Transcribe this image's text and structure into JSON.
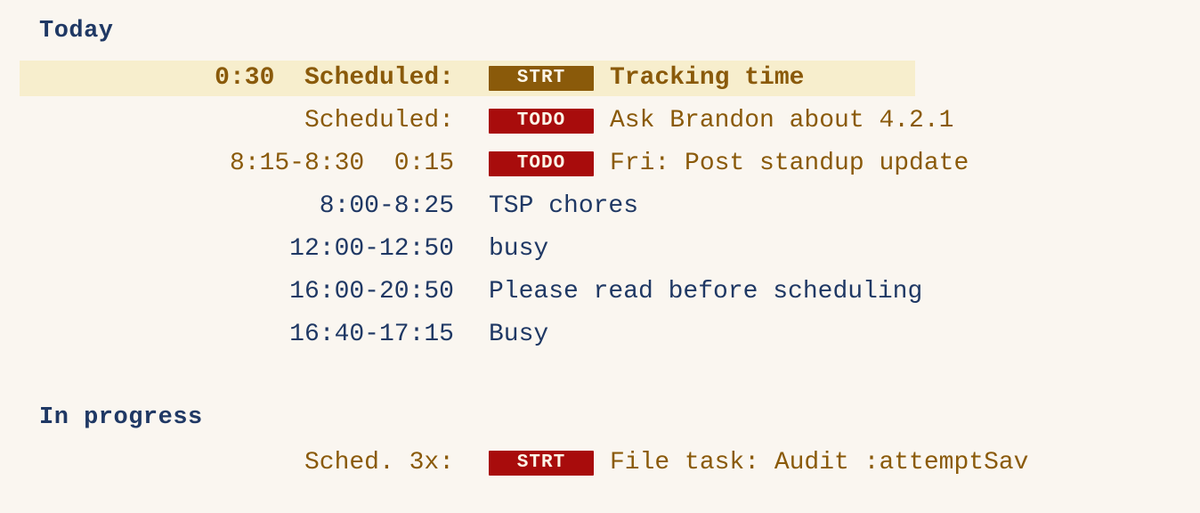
{
  "background_color": "#faf6f0",
  "colors": {
    "header": "#1f3864",
    "brown": "#8a5a0a",
    "navy": "#1f3864",
    "badge_todo": "#a80c0c",
    "badge_strt_brown": "#8a5a0a",
    "badge_strt_red": "#a80c0c",
    "row_highlight": "#f7eecd"
  },
  "sections": {
    "today": {
      "header": "Today",
      "rows": [
        {
          "time": "0:30  Scheduled:",
          "time_color": "brown",
          "bold": true,
          "badge": "STRT",
          "badge_color": "brown",
          "title": "Tracking time",
          "title_color": "brown",
          "highlighted": true
        },
        {
          "time": "Scheduled:",
          "time_color": "brown",
          "bold": false,
          "badge": "TODO",
          "badge_color": "red",
          "title": "Ask Brandon about 4.2.1",
          "title_color": "brown",
          "highlighted": false
        },
        {
          "time": "8:15-8:30  0:15",
          "time_color": "brown",
          "bold": false,
          "badge": "TODO",
          "badge_color": "red",
          "title": "Fri: Post standup update",
          "title_color": "brown",
          "highlighted": false
        },
        {
          "time": "8:00-8:25",
          "time_color": "navy",
          "bold": false,
          "badge": null,
          "badge_color": null,
          "title": "TSP chores",
          "title_color": "navy",
          "highlighted": false
        },
        {
          "time": "12:00-12:50",
          "time_color": "navy",
          "bold": false,
          "badge": null,
          "badge_color": null,
          "title": "busy",
          "title_color": "navy",
          "highlighted": false
        },
        {
          "time": "16:00-20:50",
          "time_color": "navy",
          "bold": false,
          "badge": null,
          "badge_color": null,
          "title": "Please read before scheduling",
          "title_color": "navy",
          "highlighted": false
        },
        {
          "time": "16:40-17:15",
          "time_color": "navy",
          "bold": false,
          "badge": null,
          "badge_color": null,
          "title": "Busy",
          "title_color": "navy",
          "highlighted": false
        }
      ]
    },
    "in_progress": {
      "header": "In progress",
      "rows": [
        {
          "time": "Sched. 3x:",
          "time_color": "brown",
          "bold": false,
          "badge": "STRT",
          "badge_color": "red",
          "title": "File task: Audit :attemptSav",
          "title_color": "brown",
          "highlighted": false
        }
      ]
    }
  }
}
